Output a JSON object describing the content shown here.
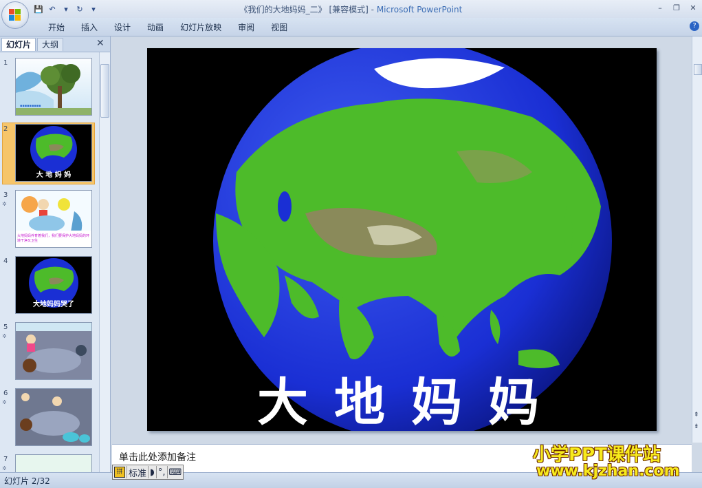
{
  "window": {
    "title_doc": "《我们的大地妈妈_二》 [兼容模式]",
    "title_sep": " - ",
    "title_app": "Microsoft PowerPoint"
  },
  "ribbon": {
    "tabs": [
      "开始",
      "插入",
      "设计",
      "动画",
      "幻灯片放映",
      "审阅",
      "视图"
    ]
  },
  "left_pane": {
    "tab_slides": "幻灯片",
    "tab_outline": "大纲",
    "thumbnails": [
      {
        "num": "1",
        "caption": ""
      },
      {
        "num": "2",
        "caption": "大 地 妈 妈"
      },
      {
        "num": "3",
        "caption": "大地妈妈养育着我们，我们要保护大地妈妈的环境干净又卫生"
      },
      {
        "num": "4",
        "caption": "大地妈妈哭了"
      },
      {
        "num": "5",
        "caption": ""
      },
      {
        "num": "6",
        "caption": ""
      },
      {
        "num": "7",
        "caption": ""
      }
    ],
    "selected": "2"
  },
  "slide": {
    "title": "大地妈妈"
  },
  "notes": {
    "placeholder": "单击此处添加备注"
  },
  "status": {
    "slide_counter": "幻灯片 2/32"
  },
  "ime": {
    "mode": "标准"
  },
  "watermark": {
    "line1": "小学PPT课件站",
    "line2": "www.kjzhan.com"
  },
  "colors": {
    "ocean": "#1a2fd4",
    "land": "#4dbb2a",
    "selection": "#f6c56a"
  }
}
